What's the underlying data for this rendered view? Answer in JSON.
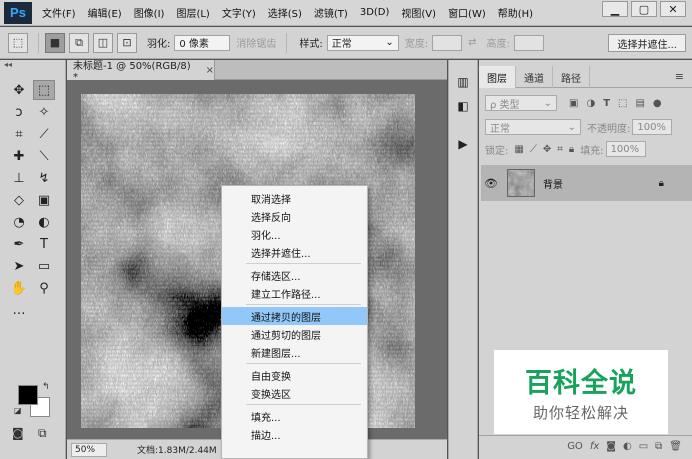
{
  "app": {
    "logo": "Ps"
  },
  "menu": [
    "文件(F)",
    "编辑(E)",
    "图像(I)",
    "图层(L)",
    "文字(Y)",
    "选择(S)",
    "滤镜(T)",
    "3D(D)",
    "视图(V)",
    "窗口(W)",
    "帮助(H)"
  ],
  "window_buttons": {
    "minimize": "▁",
    "restore": "▢",
    "close": "✕"
  },
  "options": {
    "feather_label": "羽化:",
    "feather_value": "0 像素",
    "antialias_label": "消除锯齿",
    "style_label": "样式:",
    "style_value": "正常",
    "width_label": "宽度:",
    "height_label": "高度:",
    "select_mask_button": "选择并遮住..."
  },
  "document": {
    "tab_title": "未标题-1 @ 50%(RGB/8) *",
    "tab_close": "×",
    "zoom": "50%",
    "doc_info": "文档:1.83M/2.44M"
  },
  "context_menu": {
    "groups": [
      [
        "取消选择",
        "选择反向",
        "羽化...",
        "选择并遮住..."
      ],
      [
        "存储选区...",
        "建立工作路径..."
      ],
      [
        "通过拷贝的图层",
        "通过剪切的图层",
        "新建图层..."
      ],
      [
        "自由变换",
        "变换选区"
      ],
      [
        "填充...",
        "描边..."
      ]
    ],
    "highlighted": "通过拷贝的图层"
  },
  "layers_panel": {
    "tabs": [
      "图层",
      "通道",
      "路径"
    ],
    "active_tab": "图层",
    "filter_kind": "ρ 类型",
    "blend_mode": "正常",
    "opacity_label": "不透明度:",
    "opacity_value": "100%",
    "lock_label": "锁定:",
    "fill_label": "填充:",
    "fill_value": "100%",
    "layer": {
      "name": "背景"
    },
    "bottom_icons": [
      "GO",
      "fx"
    ]
  },
  "watermark": {
    "title": "百科全说",
    "subtitle": "助你轻松解决"
  }
}
